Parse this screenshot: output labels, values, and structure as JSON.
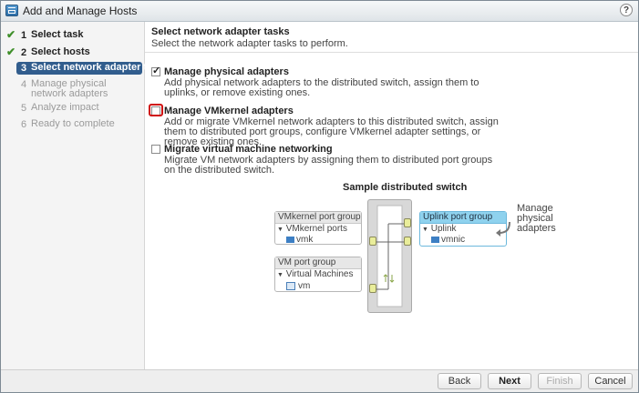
{
  "window": {
    "title": "Add and Manage Hosts",
    "help": "?"
  },
  "steps": [
    {
      "num": "1",
      "label": "Select task",
      "state": "done"
    },
    {
      "num": "2",
      "label": "Select hosts",
      "state": "done"
    },
    {
      "num": "3",
      "label": "Select network adapter tasks",
      "state": "active"
    },
    {
      "num": "4",
      "label": "Manage physical network adapters",
      "state": "todo"
    },
    {
      "num": "5",
      "label": "Analyze impact",
      "state": "todo"
    },
    {
      "num": "6",
      "label": "Ready to complete",
      "state": "todo"
    }
  ],
  "header": {
    "title": "Select network adapter tasks",
    "subtitle": "Select the network adapter tasks to perform."
  },
  "options": [
    {
      "label": "Manage physical adapters",
      "checked": true,
      "desc": "Add physical network adapters to the distributed switch, assign them to uplinks, or remove existing ones."
    },
    {
      "label": "Manage VMkernel adapters",
      "checked": false,
      "desc": "Add or migrate VMkernel network adapters to this distributed switch, assign them to distributed port groups, configure VMkernel adapter settings, or remove existing ones."
    },
    {
      "label": "Migrate virtual machine networking",
      "checked": false,
      "desc": "Migrate VM network adapters by assigning them to distributed port groups on the distributed switch."
    }
  ],
  "diagram": {
    "title": "Sample distributed switch",
    "vmk_group": {
      "name": "VMkernel port group",
      "sub": "VMkernel ports",
      "item": "vmk"
    },
    "vm_group": {
      "name": "VM port group",
      "sub": "Virtual Machines",
      "item": "vm"
    },
    "uplink_group": {
      "name": "Uplink port group",
      "sub": "Uplink",
      "item": "vmnic"
    },
    "note": "Manage physical adapters",
    "arrow_glyph": "▼"
  },
  "buttons": {
    "back": "Back",
    "next": "Next",
    "finish": "Finish",
    "cancel": "Cancel"
  },
  "colors": {
    "active_step": "#315d8d",
    "uplink": "#8fd2ee",
    "highlight": "#d01010"
  }
}
